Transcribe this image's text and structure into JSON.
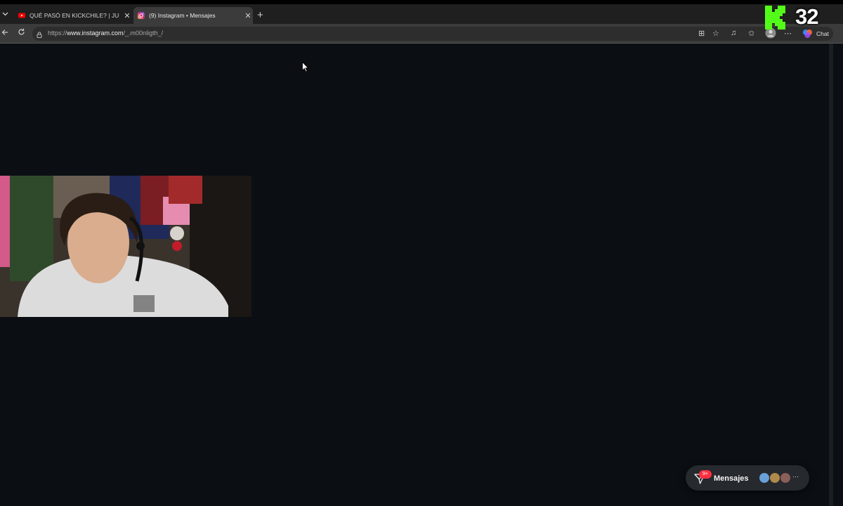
{
  "browser": {
    "tabs": [
      {
        "title": "QUÉ PASÓ EN KICKCHILE? | JUEVES",
        "favicon": "youtube-icon",
        "color": "#ff0000"
      },
      {
        "title": "(9) Instagram • Mensajes",
        "favicon": "instagram-icon",
        "color": "#d6249f",
        "active": true
      }
    ],
    "address": {
      "scheme_host_prefix": "https://",
      "host": "www.instagram.com",
      "path": "/_.m00nligth_/"
    },
    "chat_label": "Chat"
  },
  "overlay": {
    "viewer_count": "32",
    "kick_color": "#53fc18"
  },
  "messages_pill": {
    "label": "Mensajes",
    "badge": "9+",
    "badge_color": "#ff3040"
  },
  "colors": {
    "page_background": "#0b0f14",
    "tab_bar": "#1f1f1f",
    "address_bar": "#3b3b3b"
  }
}
